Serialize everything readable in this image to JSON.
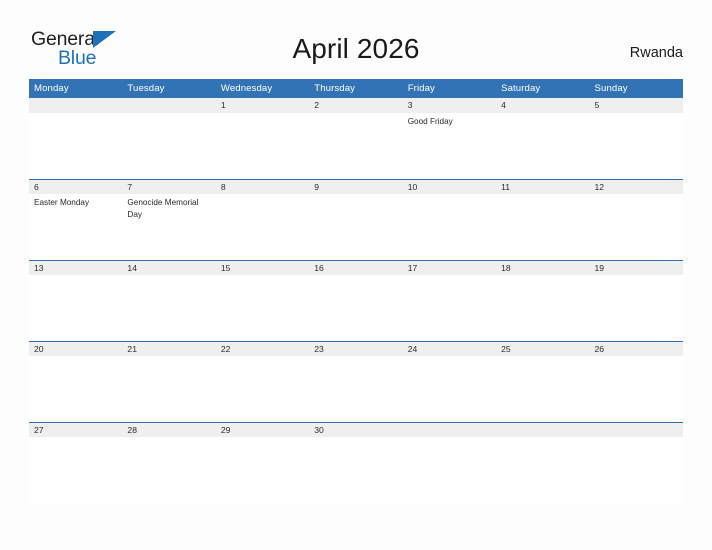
{
  "brand": {
    "name_part1": "General",
    "name_part2": "Blue",
    "triangle_color": "#1f72b8"
  },
  "header": {
    "title": "April 2026",
    "country": "Rwanda"
  },
  "theme": {
    "header_blue": "#3273b5",
    "band_gray": "#efefef",
    "rule_blue": "#2f6fb0",
    "page_background": "#fdfdfd"
  },
  "calendar": {
    "weekday_headers": [
      "Monday",
      "Tuesday",
      "Wednesday",
      "Thursday",
      "Friday",
      "Saturday",
      "Sunday"
    ],
    "weeks": [
      [
        {
          "day": "",
          "event": ""
        },
        {
          "day": "",
          "event": ""
        },
        {
          "day": "1",
          "event": ""
        },
        {
          "day": "2",
          "event": ""
        },
        {
          "day": "3",
          "event": "Good Friday"
        },
        {
          "day": "4",
          "event": ""
        },
        {
          "day": "5",
          "event": ""
        }
      ],
      [
        {
          "day": "6",
          "event": "Easter Monday"
        },
        {
          "day": "7",
          "event": "Genocide Memorial Day"
        },
        {
          "day": "8",
          "event": ""
        },
        {
          "day": "9",
          "event": ""
        },
        {
          "day": "10",
          "event": ""
        },
        {
          "day": "11",
          "event": ""
        },
        {
          "day": "12",
          "event": ""
        }
      ],
      [
        {
          "day": "13",
          "event": ""
        },
        {
          "day": "14",
          "event": ""
        },
        {
          "day": "15",
          "event": ""
        },
        {
          "day": "16",
          "event": ""
        },
        {
          "day": "17",
          "event": ""
        },
        {
          "day": "18",
          "event": ""
        },
        {
          "day": "19",
          "event": ""
        }
      ],
      [
        {
          "day": "20",
          "event": ""
        },
        {
          "day": "21",
          "event": ""
        },
        {
          "day": "22",
          "event": ""
        },
        {
          "day": "23",
          "event": ""
        },
        {
          "day": "24",
          "event": ""
        },
        {
          "day": "25",
          "event": ""
        },
        {
          "day": "26",
          "event": ""
        }
      ],
      [
        {
          "day": "27",
          "event": ""
        },
        {
          "day": "28",
          "event": ""
        },
        {
          "day": "29",
          "event": ""
        },
        {
          "day": "30",
          "event": ""
        },
        {
          "day": "",
          "event": ""
        },
        {
          "day": "",
          "event": ""
        },
        {
          "day": "",
          "event": ""
        }
      ]
    ]
  }
}
